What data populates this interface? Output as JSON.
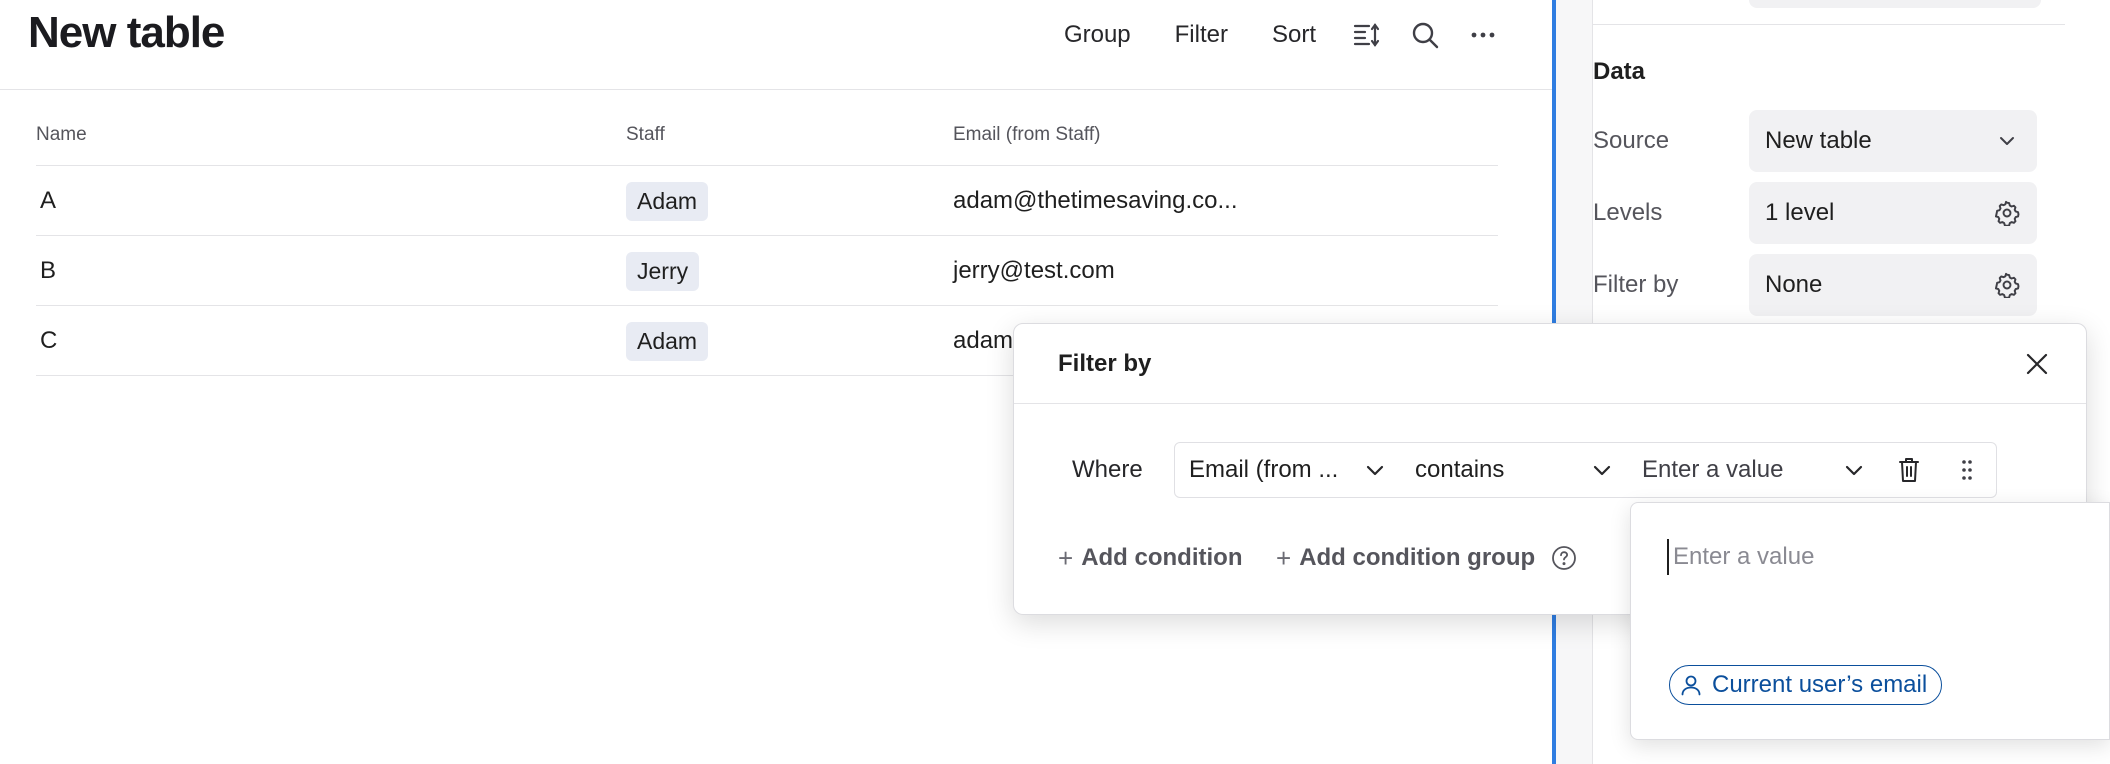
{
  "page": {
    "title": "New table"
  },
  "toolbar": {
    "group_label": "Group",
    "filter_label": "Filter",
    "sort_label": "Sort",
    "icons": [
      "row-height-icon",
      "search-icon",
      "more-icon"
    ]
  },
  "table": {
    "columns": [
      "Name",
      "Staff",
      "Email (from Staff)"
    ],
    "rows": [
      {
        "name": "A",
        "staff": "Adam",
        "email": "adam@thetimesaving.co..."
      },
      {
        "name": "B",
        "staff": "Jerry",
        "email": "jerry@test.com"
      },
      {
        "name": "C",
        "staff": "Adam",
        "email": "adam"
      }
    ]
  },
  "panel": {
    "section_title": "Data",
    "source": {
      "label": "Source",
      "value": "New table"
    },
    "levels": {
      "label": "Levels",
      "value": "1 level"
    },
    "filter_by": {
      "label": "Filter by",
      "value": "None"
    }
  },
  "filter_popover": {
    "title": "Filter by",
    "where_label": "Where",
    "field_value": "Email (from ...",
    "operator_value": "contains",
    "value_placeholder": "Enter a value",
    "add_condition_label": "Add condition",
    "add_condition_group_label": "Add condition group"
  },
  "value_dropdown": {
    "input_placeholder": "Enter a value",
    "option_label": "Current user’s email"
  },
  "colors": {
    "accent_divider": "#2f7de1",
    "chip_bg": "#e8ebf3",
    "link_blue": "#0b4f9c"
  }
}
